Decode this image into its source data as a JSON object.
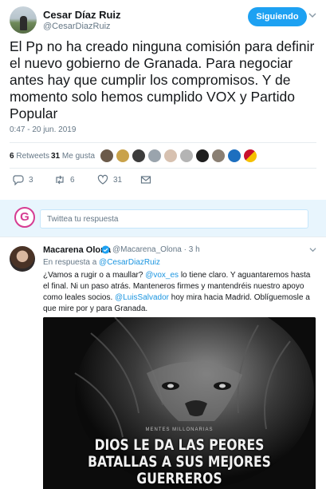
{
  "tweet": {
    "author_name": "Cesar Díaz Ruiz",
    "author_handle": "@CesarDiazRuiz",
    "follow_label": "Siguiendo",
    "text": "El Pp no ha creado ninguna comisión para definir el nuevo gobierno de Granada. Para negociar antes hay que cumplir los compromisos. Y de momento solo hemos cumplido VOX y Partido Popular",
    "timestamp": "0:47 - 20 jun. 2019",
    "retweets_count": "6",
    "retweets_label": "Retweets",
    "likes_count": "31",
    "likes_label": "Me gusta",
    "actions": {
      "reply_count": "3",
      "retweet_count": "6",
      "like_count": "31"
    }
  },
  "reply_box": {
    "placeholder": "Twittea tu respuesta",
    "logo_letter": "G"
  },
  "reply": {
    "author_name": "Macarena Olona",
    "author_handle": "@Macarena_Olona",
    "age": "· 3 h",
    "in_reply_prefix": "En respuesta a",
    "in_reply_handle": "@CesarDiazRuiz",
    "text_part1": "¿Vamos a rugir o a maullar? ",
    "mention1": "@vox_es",
    "text_part2": " lo tiene claro. Y aguantaremos hasta el final. Ni un paso atrás. Manteneros firmes y mantendréis nuestro apoyo como leales socios. ",
    "mention2": "@LuisSalvador",
    "text_part3": " hoy mira hacia Madrid. Oblíguemosle a que mire por y para Granada.",
    "image": {
      "brand": "MENTES MILLONARIAS",
      "line1": "DIOS LE DA LAS PEORES",
      "line2": "BATALLAS A SUS MEJORES",
      "line3": "GUERREROS"
    }
  },
  "colors": {
    "accent": "#1da1f2",
    "link": "#1b95e0",
    "muted": "#657786",
    "reply_bar": "#e8f5fd",
    "logo": "#d63c92"
  }
}
